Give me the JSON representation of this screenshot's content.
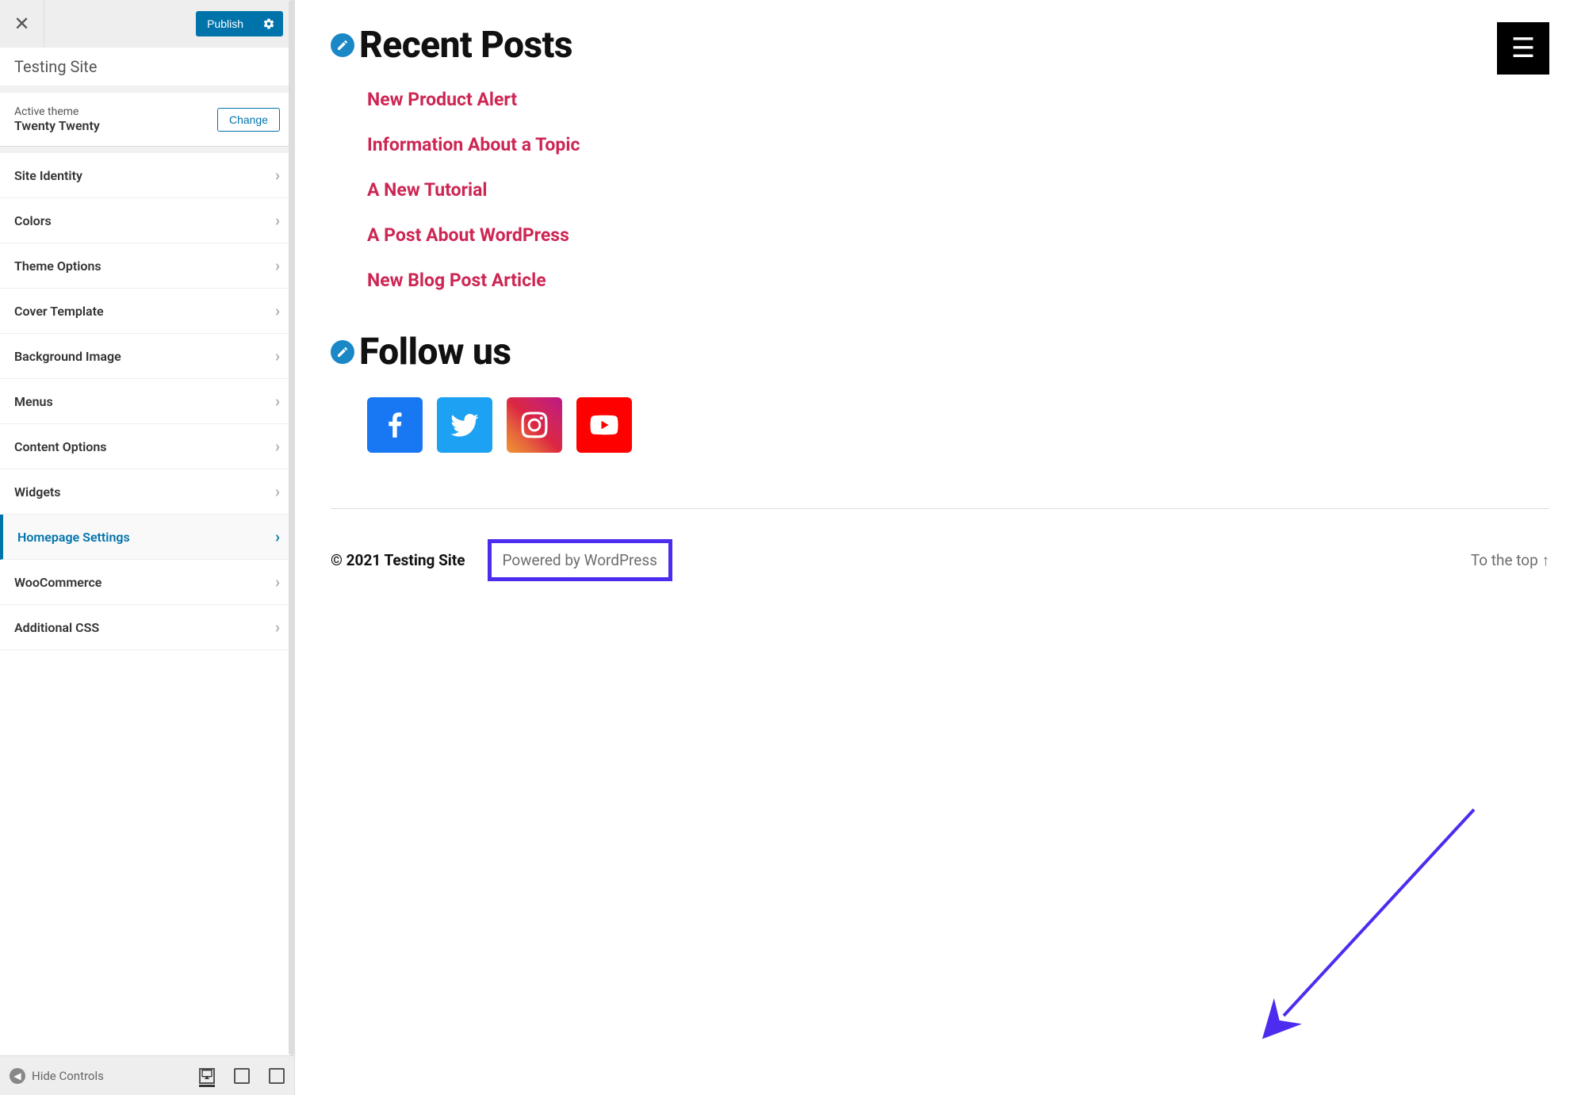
{
  "sidebar": {
    "site_name": "Testing Site",
    "publish_label": "Publish",
    "active_theme_label": "Active theme",
    "theme_name": "Twenty Twenty",
    "change_label": "Change",
    "menu": [
      {
        "label": "Site Identity",
        "active": false
      },
      {
        "label": "Colors",
        "active": false
      },
      {
        "label": "Theme Options",
        "active": false
      },
      {
        "label": "Cover Template",
        "active": false
      },
      {
        "label": "Background Image",
        "active": false
      },
      {
        "label": "Menus",
        "active": false
      },
      {
        "label": "Content Options",
        "active": false
      },
      {
        "label": "Widgets",
        "active": false
      },
      {
        "label": "Homepage Settings",
        "active": true
      },
      {
        "label": "WooCommerce",
        "active": false
      },
      {
        "label": "Additional CSS",
        "active": false
      }
    ],
    "collapse_label": "Hide Controls"
  },
  "preview": {
    "recent_posts_title": "Recent Posts",
    "posts": [
      "New Product Alert",
      "Information About a Topic",
      "A New Tutorial",
      "A Post About WordPress",
      "New Blog Post Article"
    ],
    "follow_title": "Follow us",
    "copyright": "© 2021 Testing Site",
    "powered_by": "Powered by WordPress",
    "to_top": "To the top ↑"
  }
}
